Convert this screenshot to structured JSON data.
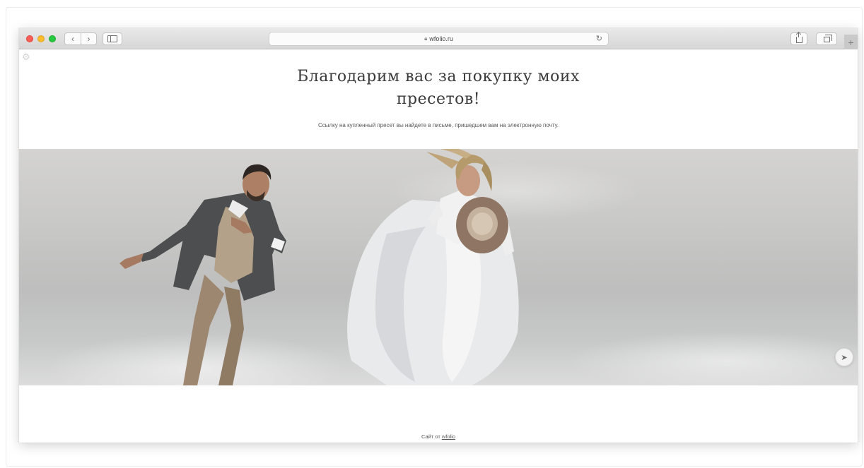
{
  "browser": {
    "url": "wfolio.ru",
    "lock_icon": "lock-icon",
    "reload_icon": "reload-icon"
  },
  "page": {
    "heading_line1": "Благодарим вас за покупку моих",
    "heading_line2": "пресетов!",
    "subtitle": "Ссылку на купленный пресет вы найдете в письме, пришедшем вам на электронную почту.",
    "hero_image_alt": "couple-jumping-photo",
    "footer_prefix": "Сайт от",
    "footer_link": "wfolio"
  },
  "colors": {
    "toolbar": "#d6d6d6",
    "heading": "#3a3a3a",
    "sky": "#c9c9c7"
  }
}
